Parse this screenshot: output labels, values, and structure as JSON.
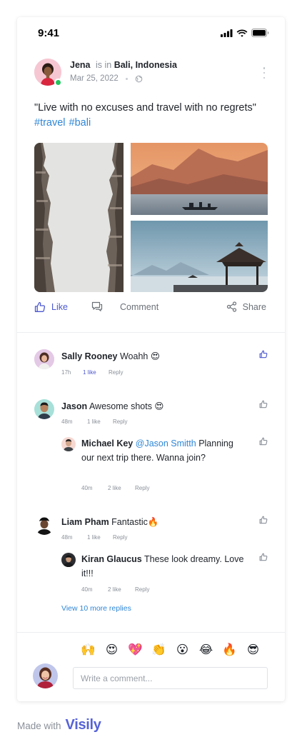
{
  "status_bar": {
    "time": "9:41"
  },
  "post": {
    "author": "Jena",
    "is_in": "is in",
    "location": "Bali, Indonesia",
    "date": "Mar 25, 2022",
    "quote": "\"Live with no excuses and travel with no regrets\"",
    "tags": [
      "#travel",
      "#bali"
    ]
  },
  "actions": {
    "like": "Like",
    "comment": "Comment",
    "share": "Share"
  },
  "comments": [
    {
      "name": "Sally Rooney",
      "text": "Woahh 😍",
      "time": "17h",
      "likes": "1 like",
      "reply": "Reply",
      "liked": true
    },
    {
      "name": "Jason",
      "text": "Awesome shots 😍",
      "time": "48m",
      "likes": "1 like",
      "reply": "Reply",
      "liked": false,
      "replies": [
        {
          "name": "Michael Key",
          "mention": "@Jason Smitth",
          "text": "Planning our next trip there. Wanna join?",
          "time": "40m",
          "likes": "2 like",
          "reply": "Reply"
        }
      ]
    },
    {
      "name": "Liam Pham",
      "text": "Fantastic🔥",
      "time": "48m",
      "likes": "1 like",
      "reply": "Reply",
      "liked": false,
      "replies": [
        {
          "name": "Kiran Glaucus",
          "text": "These look dreamy. Love it!!!",
          "time": "40m",
          "likes": "2 like",
          "reply": "Reply"
        }
      ]
    }
  ],
  "view_more": "View 10 more replies",
  "reactions": [
    "🙌",
    "😍",
    "💖",
    "👏",
    "😮",
    "😂",
    "🔥",
    "😎"
  ],
  "composer": {
    "placeholder": "Write a comment..."
  },
  "footer": {
    "made_with": "Made with",
    "brand": "Visily"
  },
  "colors": {
    "accent": "#4c58cf",
    "link": "#2f86d6",
    "online": "#22c55e"
  }
}
